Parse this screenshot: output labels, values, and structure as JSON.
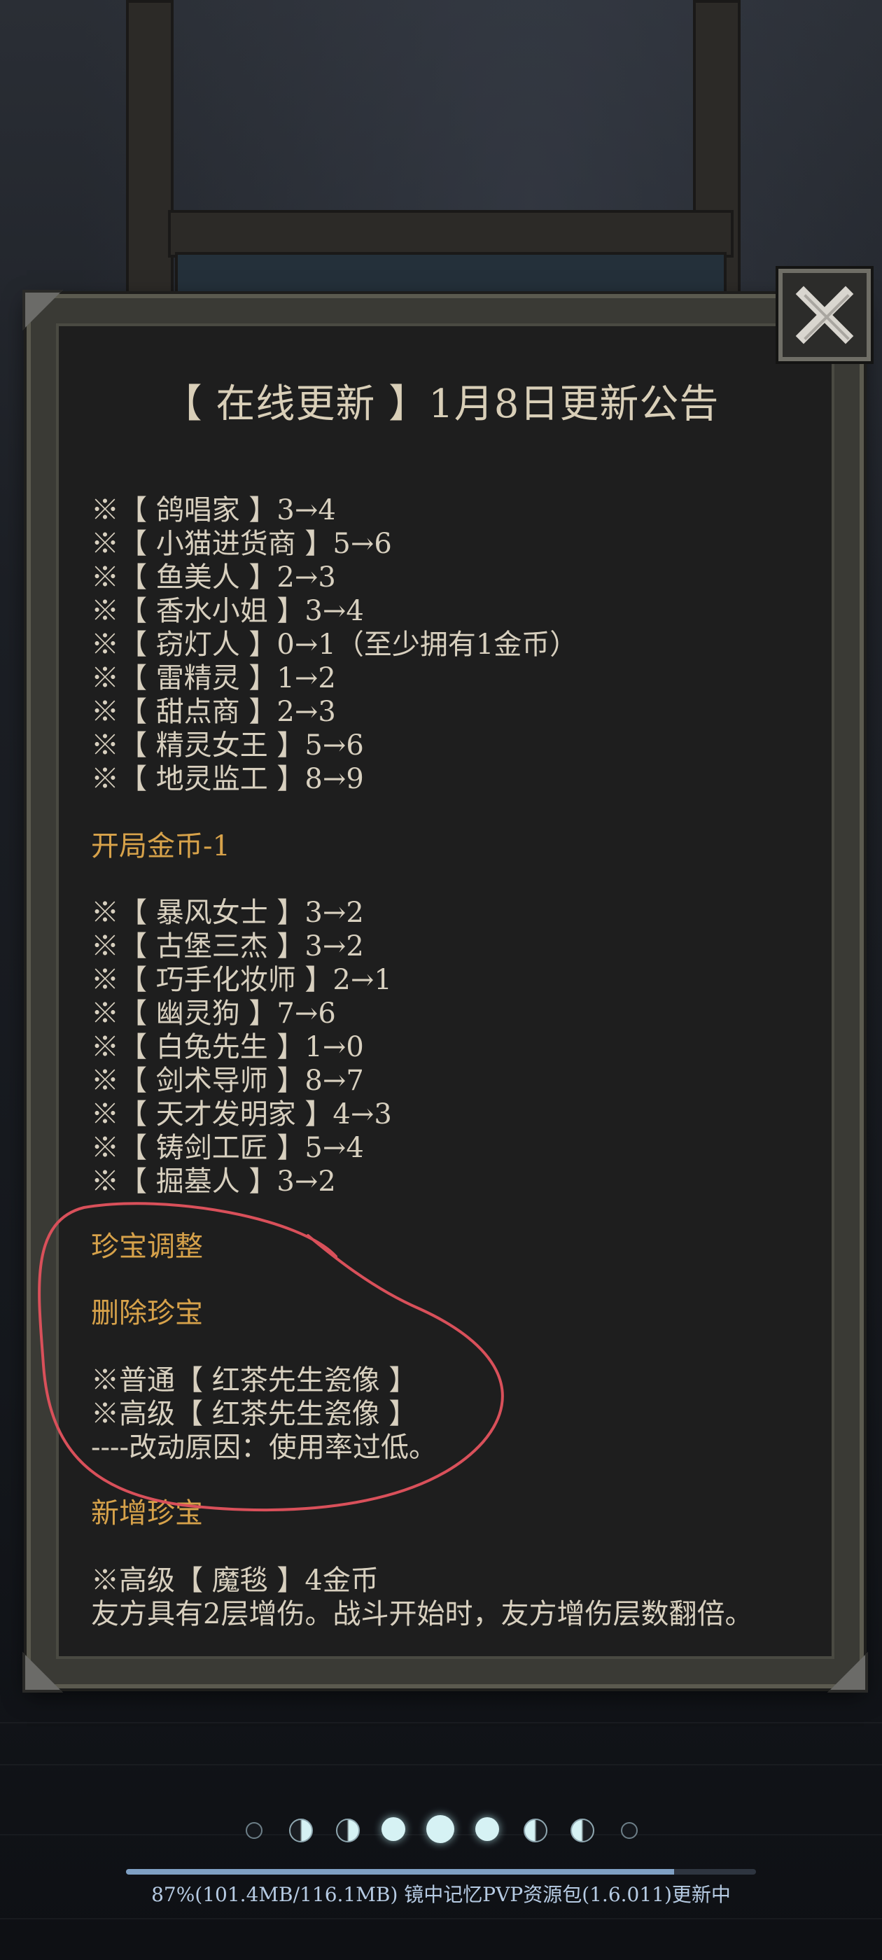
{
  "notice": {
    "title": "【 在线更新 】1月8日更新公告",
    "lines": [
      {
        "text": "※【 鸽唱家 】3→4",
        "kind": "item"
      },
      {
        "text": "※【 小猫进货商 】5→6",
        "kind": "item"
      },
      {
        "text": "※【 鱼美人 】2→3",
        "kind": "item"
      },
      {
        "text": "※【 香水小姐 】3→4",
        "kind": "item"
      },
      {
        "text": "※【 窃灯人 】0→1（至少拥有1金币）",
        "kind": "item"
      },
      {
        "text": "※【 雷精灵 】1→2",
        "kind": "item"
      },
      {
        "text": "※【 甜点商 】2→3",
        "kind": "item"
      },
      {
        "text": "※【 精灵女王 】5→6",
        "kind": "item"
      },
      {
        "text": "※【 地灵监工 】8→9",
        "kind": "item"
      },
      {
        "text": "开局金币-1",
        "kind": "section"
      },
      {
        "text": "※【 暴风女士 】3→2",
        "kind": "item"
      },
      {
        "text": "※【 古堡三杰 】3→2",
        "kind": "item"
      },
      {
        "text": "※【 巧手化妆师 】2→1",
        "kind": "item"
      },
      {
        "text": "※【 幽灵狗 】7→6",
        "kind": "item"
      },
      {
        "text": "※【 白兔先生 】1→0",
        "kind": "item"
      },
      {
        "text": "※【 剑术导师 】8→7",
        "kind": "item"
      },
      {
        "text": "※【 天才发明家 】4→3",
        "kind": "item"
      },
      {
        "text": "※【 铸剑工匠 】5→4",
        "kind": "item"
      },
      {
        "text": "※【 掘墓人 】3→2",
        "kind": "item"
      },
      {
        "text": "珍宝调整",
        "kind": "section"
      },
      {
        "text": "删除珍宝",
        "kind": "section"
      },
      {
        "text": "※普通【 红茶先生瓷像 】",
        "kind": "item"
      },
      {
        "text": "※高级【 红茶先生瓷像 】",
        "kind": "item"
      },
      {
        "text": "----改动原因：使用率过低。",
        "kind": "item"
      },
      {
        "text": "新增珍宝",
        "kind": "section"
      },
      {
        "text": "※高级【 魔毯 】4金币",
        "kind": "item"
      },
      {
        "text": "友方具有2层增伤。战斗开始时，友方增伤层数翻倍。",
        "kind": "item"
      }
    ]
  },
  "close_icon": "close-x-icon",
  "pagination": {
    "count": 9,
    "active_index": 4
  },
  "download": {
    "progress_text": "87%(101.4MB/116.1MB)   镜中记忆PVP资源包(1.6.011)更新中",
    "progress_fraction": 0.87
  },
  "colors": {
    "text": "#d8d0bf",
    "section": "#d7a24a",
    "annotation": "#d9505a",
    "progress": "#7fa0c4"
  }
}
